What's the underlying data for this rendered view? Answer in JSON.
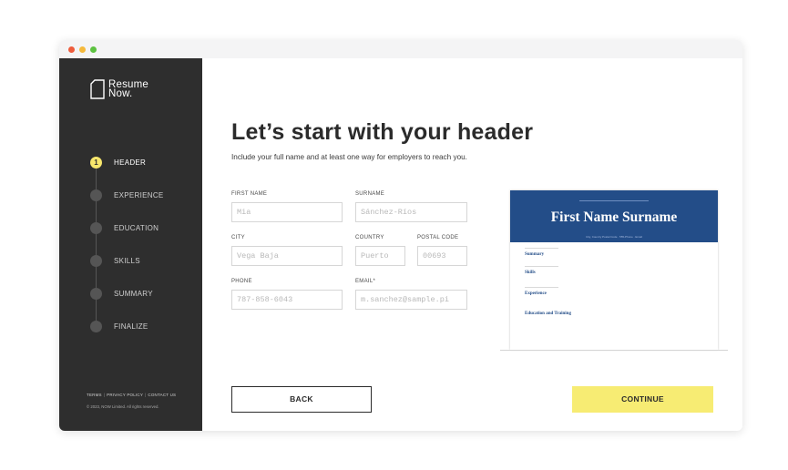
{
  "window": {
    "controls": [
      "close",
      "minimize",
      "maximize"
    ],
    "colors": {
      "close": "#ee5c3c",
      "minimize": "#f5b93b",
      "maximize": "#5dc241"
    }
  },
  "sidebar": {
    "logo": {
      "line1": "Resume",
      "line2": "Now.",
      "icon": "document-icon"
    },
    "steps": [
      {
        "number": "1",
        "label": "HEADER",
        "active": true
      },
      {
        "number": "",
        "label": "EXPERIENCE",
        "active": false
      },
      {
        "number": "",
        "label": "EDUCATION",
        "active": false
      },
      {
        "number": "",
        "label": "SKILLS",
        "active": false
      },
      {
        "number": "",
        "label": "SUMMARY",
        "active": false
      },
      {
        "number": "",
        "label": "FINALIZE",
        "active": false
      }
    ],
    "footer": {
      "links": [
        "TERMS",
        "PRIVACY POLICY",
        "CONTACT US"
      ],
      "copyright": "© 2023, NOW Limited. All rights reserved."
    },
    "colors": {
      "background": "#2e2e2e",
      "active_step": "#f7e66c"
    }
  },
  "main": {
    "title": "Let’s start with your header",
    "subtitle": "Include your full name and at least one way for employers to reach you.",
    "fields": {
      "first_name": {
        "label": "FIRST NAME",
        "placeholder": "Mia"
      },
      "surname": {
        "label": "SURNAME",
        "placeholder": "Sánchez-Ríos"
      },
      "city": {
        "label": "CITY",
        "placeholder": "Vega Baja"
      },
      "country": {
        "label": "COUNTRY",
        "placeholder": "Puerto"
      },
      "postal_code": {
        "label": "POSTAL CODE",
        "placeholder": "00693"
      },
      "phone": {
        "label": "PHONE",
        "placeholder": "787-858-6043"
      },
      "email": {
        "label": "EMAIL*",
        "placeholder": "m.sanchez@sample.pi"
      }
    },
    "buttons": {
      "back": "BACK",
      "continue": "CONTINUE"
    },
    "colors": {
      "continue_button": "#f7ec73"
    }
  },
  "preview": {
    "name": "First Name Surname",
    "contact_line": "City, Country Postal Code · 555-Phone · Email",
    "sections": [
      "Summary",
      "Skills",
      "Experience",
      "Education and Training"
    ],
    "colors": {
      "header": "#234d88"
    }
  }
}
